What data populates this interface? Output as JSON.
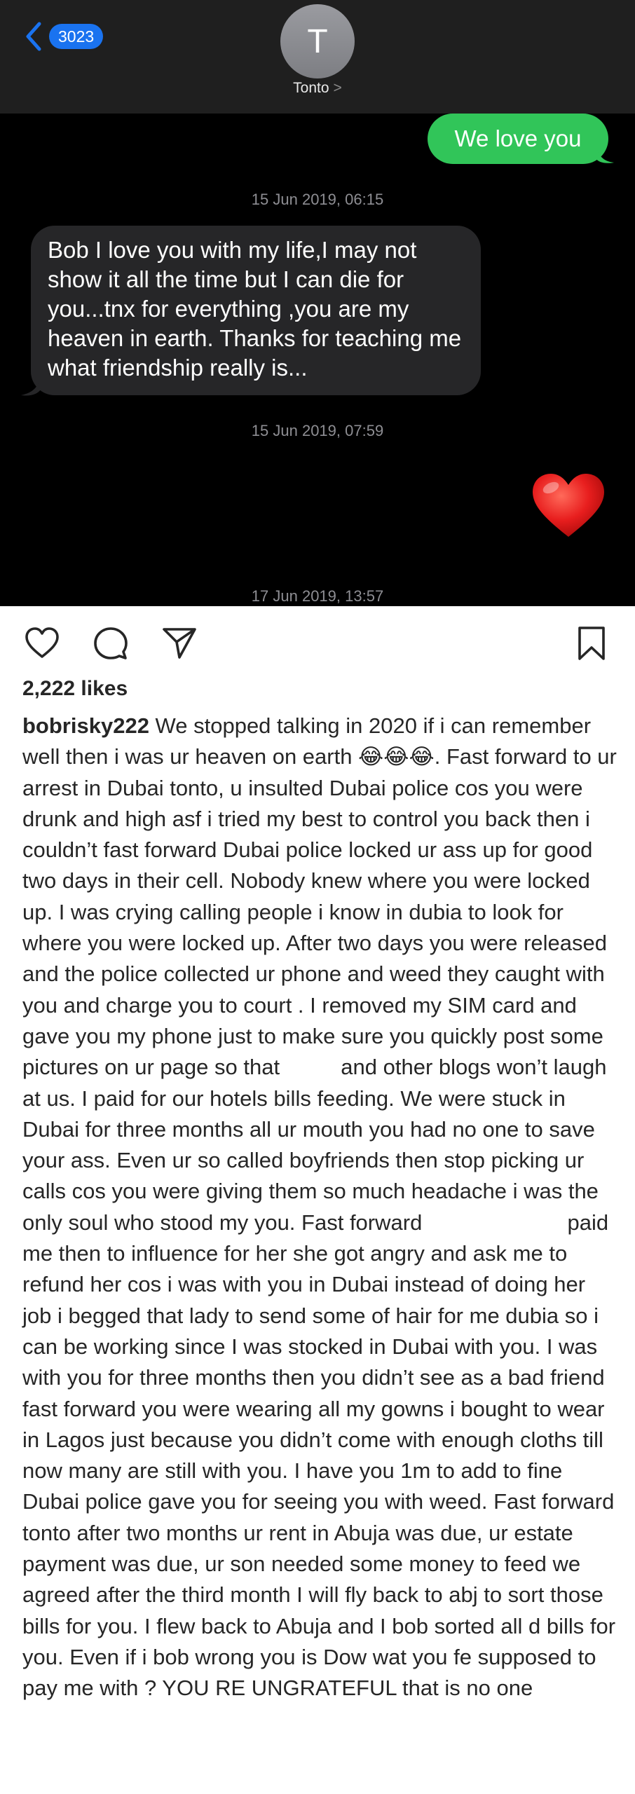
{
  "message_screenshot": {
    "back_badge_count": "3023",
    "contact_initial": "T",
    "contact_name": "Tonto",
    "contact_chevron": ">",
    "outgoing_message": "We love you",
    "timestamp_1": "15 Jun 2019, 06:15",
    "incoming_message": "Bob I love you with my life,I may not show it all the time but I can die for you...tnx for everything ,you are my heaven in earth. Thanks for teaching me what friendship really is...",
    "timestamp_2": "15 Jun 2019, 07:59",
    "reaction_icon": "red-heart",
    "timestamp_3": "17 Jun 2019, 13:57",
    "colors": {
      "outgoing_bubble": "#31c559",
      "incoming_bubble": "#262628",
      "badge": "#1a73f0",
      "background": "#000000"
    }
  },
  "post": {
    "actions": {
      "like_icon": "heart-outline",
      "comment_icon": "comment-bubble",
      "share_icon": "paper-plane",
      "save_icon": "bookmark"
    },
    "likes": "2,222 likes",
    "username": "bobrisky222",
    "caption_part_1": " We stopped talking in 2020 if i can remember well then i was ur heaven on earth 😂😂😂. Fast forward to ur arrest in Dubai tonto, u insulted Dubai police cos you were drunk and high asf i tried my best to control you back then i couldn’t fast forward Dubai police locked ur ass up for good two days in their cell. Nobody knew where you were locked up. I was crying calling people i know in dubia to look for where you were locked up. After two days you were released and the police collected ur phone and weed they caught with you and charge you to court . I removed my SIM card and gave you my phone just to make sure you quickly post some pictures on ur page so that ",
    "caption_part_2": " and other blogs won’t laugh at us. I paid for our hotels bills feeding. We were stuck in Dubai for three months all ur mouth you had no one to save your ass. Even ur so called boyfriends then stop picking ur calls cos you were giving them so much headache i was the only soul who stood my you. Fast forward ",
    "caption_part_3": " paid me then to influence for her she got angry and ask me to refund her cos i was with you in Dubai instead of doing her job i begged that lady to send some of hair for me dubia so i can be working since I was stocked in Dubai with you. I was with you for three months then you didn’t see as a bad friend fast forward you were wearing all my gowns i bought to wear in Lagos just because you didn’t come with enough cloths till now many are still with you. I have you 1m to add to fine Dubai police gave you for seeing you with weed. Fast forward tonto after two months ur rent in Abuja was due, ur estate payment was due, ur son needed some money to feed we agreed after the third month I will fly back to abj to sort those bills for you. I flew back to Abuja and I bob sorted all d bills for you. Even if i bob wrong you is Dow wat you fe supposed to pay me with ? YOU RE UNGRATEFUL that is no one"
  }
}
